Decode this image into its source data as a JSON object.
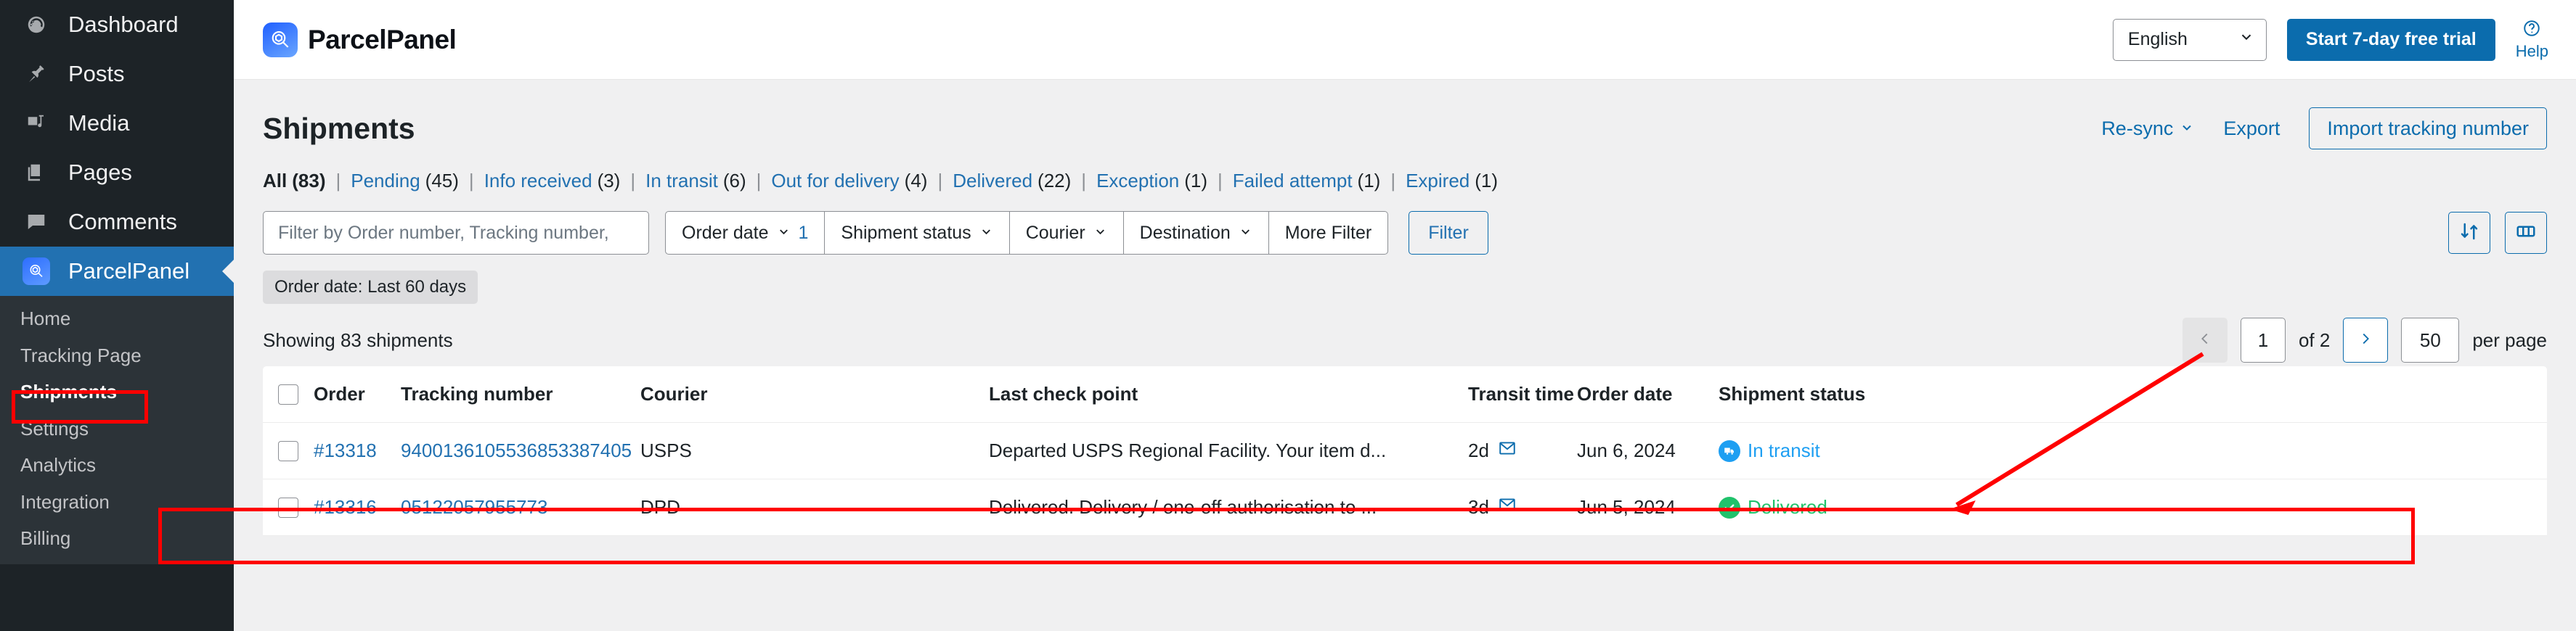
{
  "wp_sidebar": {
    "items": [
      {
        "label": "Dashboard",
        "icon": "dashboard-icon",
        "active": false
      },
      {
        "label": "Posts",
        "icon": "pin-icon",
        "active": false
      },
      {
        "label": "Media",
        "icon": "media-icon",
        "active": false
      },
      {
        "label": "Pages",
        "icon": "pages-icon",
        "active": false
      },
      {
        "label": "Comments",
        "icon": "comment-icon",
        "active": false
      },
      {
        "label": "ParcelPanel",
        "icon": "parcelpanel-icon",
        "active": true
      }
    ],
    "submenu": [
      {
        "label": "Home",
        "current": false
      },
      {
        "label": "Tracking Page",
        "current": false
      },
      {
        "label": "Shipments",
        "current": true
      },
      {
        "label": "Settings",
        "current": false
      },
      {
        "label": "Analytics",
        "current": false
      },
      {
        "label": "Integration",
        "current": false
      },
      {
        "label": "Billing",
        "current": false
      }
    ]
  },
  "header": {
    "brand": "ParcelPanel",
    "brand_icon": "parcelpanel-logo-icon",
    "language": "English",
    "language_chevron": "chevron-down-icon",
    "cta": "Start 7-day free trial",
    "help_label": "Help",
    "help_icon": "question-circle-icon"
  },
  "page": {
    "title": "Shipments",
    "resync": "Re-sync",
    "resync_chevron": "chevron-down-icon",
    "export": "Export",
    "import": "Import tracking number"
  },
  "status_tabs": [
    {
      "label": "All",
      "count": "(83)",
      "active": true
    },
    {
      "label": "Pending",
      "count": "(45)",
      "active": false
    },
    {
      "label": "Info received",
      "count": "(3)",
      "active": false
    },
    {
      "label": "In transit",
      "count": "(6)",
      "active": false
    },
    {
      "label": "Out for delivery",
      "count": "(4)",
      "active": false
    },
    {
      "label": "Delivered",
      "count": "(22)",
      "active": false
    },
    {
      "label": "Exception",
      "count": "(1)",
      "active": false
    },
    {
      "label": "Failed attempt",
      "count": "(1)",
      "active": false
    },
    {
      "label": "Expired",
      "count": "(1)",
      "active": false
    }
  ],
  "separator": "|",
  "filters": {
    "search_placeholder": "Filter by Order number, Tracking number,",
    "search_value": "",
    "segments": [
      {
        "label": "Order date",
        "chevron": "chevron-down-icon",
        "badge": "1"
      },
      {
        "label": "Shipment status",
        "chevron": "chevron-down-icon",
        "badge": ""
      },
      {
        "label": "Courier",
        "chevron": "chevron-down-icon",
        "badge": ""
      },
      {
        "label": "Destination",
        "chevron": "chevron-down-icon",
        "badge": ""
      },
      {
        "label": "More Filter",
        "chevron": "",
        "badge": ""
      }
    ],
    "apply": "Filter",
    "sort_icon": "sort-arrows-icon",
    "columns_icon": "columns-icon",
    "active_chip": "Order date: Last 60 days"
  },
  "summary": {
    "showing": "Showing 83 shipments"
  },
  "pagination": {
    "prev_icon": "chevron-left-icon",
    "page": "1",
    "of": "of 2",
    "next_icon": "chevron-right-icon",
    "per_page_value": "50",
    "per_page_label": "per page"
  },
  "table": {
    "columns": [
      "Order",
      "Tracking number",
      "Courier",
      "Last check point",
      "Transit time",
      "Order date",
      "Shipment status"
    ],
    "rows": [
      {
        "order": "#13318",
        "tracking": "9400136105536853387405",
        "courier": "USPS",
        "checkpoint": "Departed USPS Regional Facility. Your item d...",
        "transit": "2d",
        "mail_icon": "envelope-icon",
        "order_date": "Jun 6, 2024",
        "status": "In transit",
        "status_color": "#1e9ff2",
        "status_icon": "truck-icon",
        "highlighted": true
      },
      {
        "order": "#13316",
        "tracking": "05122057955773",
        "courier": "DPD",
        "checkpoint": "Delivered. Delivery / one-off authorisation to ...",
        "transit": "3d",
        "mail_icon": "envelope-icon",
        "order_date": "Jun 5, 2024",
        "status": "Delivered",
        "status_color": "#20c26b",
        "status_icon": "check-circle-icon",
        "highlighted": false
      }
    ]
  },
  "annotations": {
    "arrow_color": "#ff0000",
    "highlight_color": "#ff0000"
  }
}
